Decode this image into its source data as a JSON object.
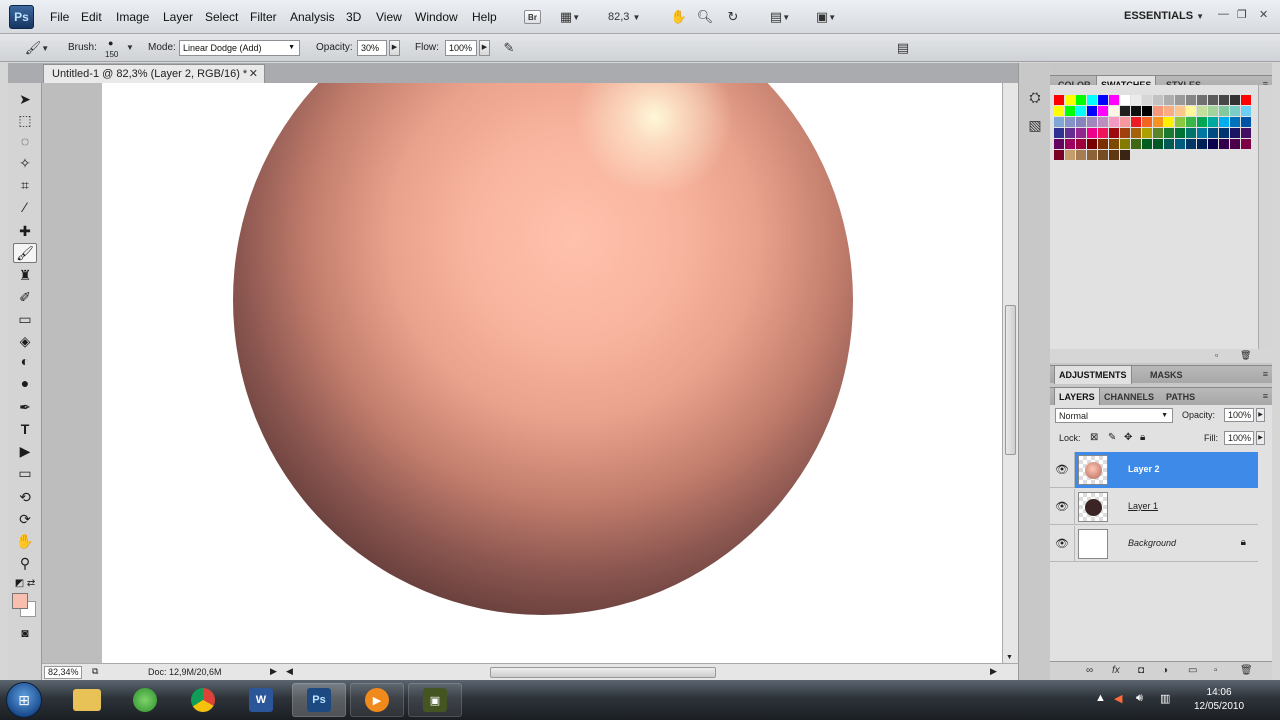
{
  "menubar": {
    "logo": "Ps",
    "items": [
      "File",
      "Edit",
      "Image",
      "Layer",
      "Select",
      "Filter",
      "Analysis",
      "3D",
      "View",
      "Window",
      "Help"
    ],
    "bridge_label": "Br",
    "zoom_value": "82,3",
    "workspace": "ESSENTIALS"
  },
  "options": {
    "brush_label": "Brush:",
    "brush_size": "150",
    "mode_label": "Mode:",
    "mode_value": "Linear Dodge (Add)",
    "opacity_label": "Opacity:",
    "opacity_value": "30%",
    "flow_label": "Flow:",
    "flow_value": "100%"
  },
  "document": {
    "tab_title": "Untitled-1 @ 82,3% (Layer 2, RGB/16) *",
    "zoom_status": "82,34%",
    "doc_info": "Doc: 12,9M/20,6M"
  },
  "colors": {
    "foreground": "#f9bfae",
    "background": "#ffffff",
    "selection": "#3d8ae8"
  },
  "panels": {
    "top_tabs": [
      "COLOR",
      "SWATCHES",
      "STYLES"
    ],
    "mid_tabs": [
      "ADJUSTMENTS",
      "MASKS"
    ],
    "layer_tabs": [
      "LAYERS",
      "CHANNELS",
      "PATHS"
    ],
    "swatches": [
      "#ff0000",
      "#ffff00",
      "#00ff00",
      "#00ffff",
      "#0000ff",
      "#ff00ff",
      "#ffffff",
      "#ebebeb",
      "#d6d6d6",
      "#c2c2c2",
      "#adadad",
      "#999999",
      "#858585",
      "#707070",
      "#5c5c5c",
      "#474747",
      "#333333",
      "#ff0000",
      "#ffff00",
      "#00ff00",
      "#00ffff",
      "#0000ff",
      "#ff00ff",
      "#fdf5e6",
      "#1f1f1f",
      "#0f0f0f",
      "#000000",
      "#f7977a",
      "#f9ad81",
      "#fdc68a",
      "#fff79a",
      "#c4df9b",
      "#a2d39c",
      "#82ca9d",
      "#7bcdc8",
      "#6ecff6",
      "#7ea7d8",
      "#8493ca",
      "#8882be",
      "#a187be",
      "#bc8dbf",
      "#f49ac2",
      "#f6989d",
      "#ed1c24",
      "#f26522",
      "#f7941d",
      "#fff200",
      "#8dc73f",
      "#39b54a",
      "#00a651",
      "#00a99d",
      "#00aeef",
      "#0072bc",
      "#0054a6",
      "#2e3192",
      "#662d91",
      "#92278f",
      "#ec008c",
      "#ed145b",
      "#9e0b0f",
      "#a0410d",
      "#a36209",
      "#aba000",
      "#598527",
      "#1a7b30",
      "#007236",
      "#00746b",
      "#0076a3",
      "#004b80",
      "#003471",
      "#1b1464",
      "#440e62",
      "#630460",
      "#9e005d",
      "#9e0039",
      "#790000",
      "#7b2e00",
      "#7d4900",
      "#827b00",
      "#406618",
      "#005e20",
      "#005826",
      "#005952",
      "#005b7f",
      "#003663",
      "#002157",
      "#0d004c",
      "#32004b",
      "#4b0049",
      "#7b0046",
      "#7a0026",
      "#c69c6d",
      "#a67c52",
      "#8c6239",
      "#754c24",
      "#603913",
      "#3c2415"
    ],
    "blend_mode": "Normal",
    "opacity_label": "Opacity:",
    "opacity_value": "100%",
    "lock_label": "Lock:",
    "fill_label": "Fill:",
    "fill_value": "100%",
    "layers": [
      {
        "name": "Layer 2",
        "selected": true
      },
      {
        "name": "Layer 1",
        "selected": false
      },
      {
        "name": "Background",
        "selected": false
      }
    ]
  },
  "taskbar": {
    "time": "14:06",
    "date": "12/05/2010"
  }
}
